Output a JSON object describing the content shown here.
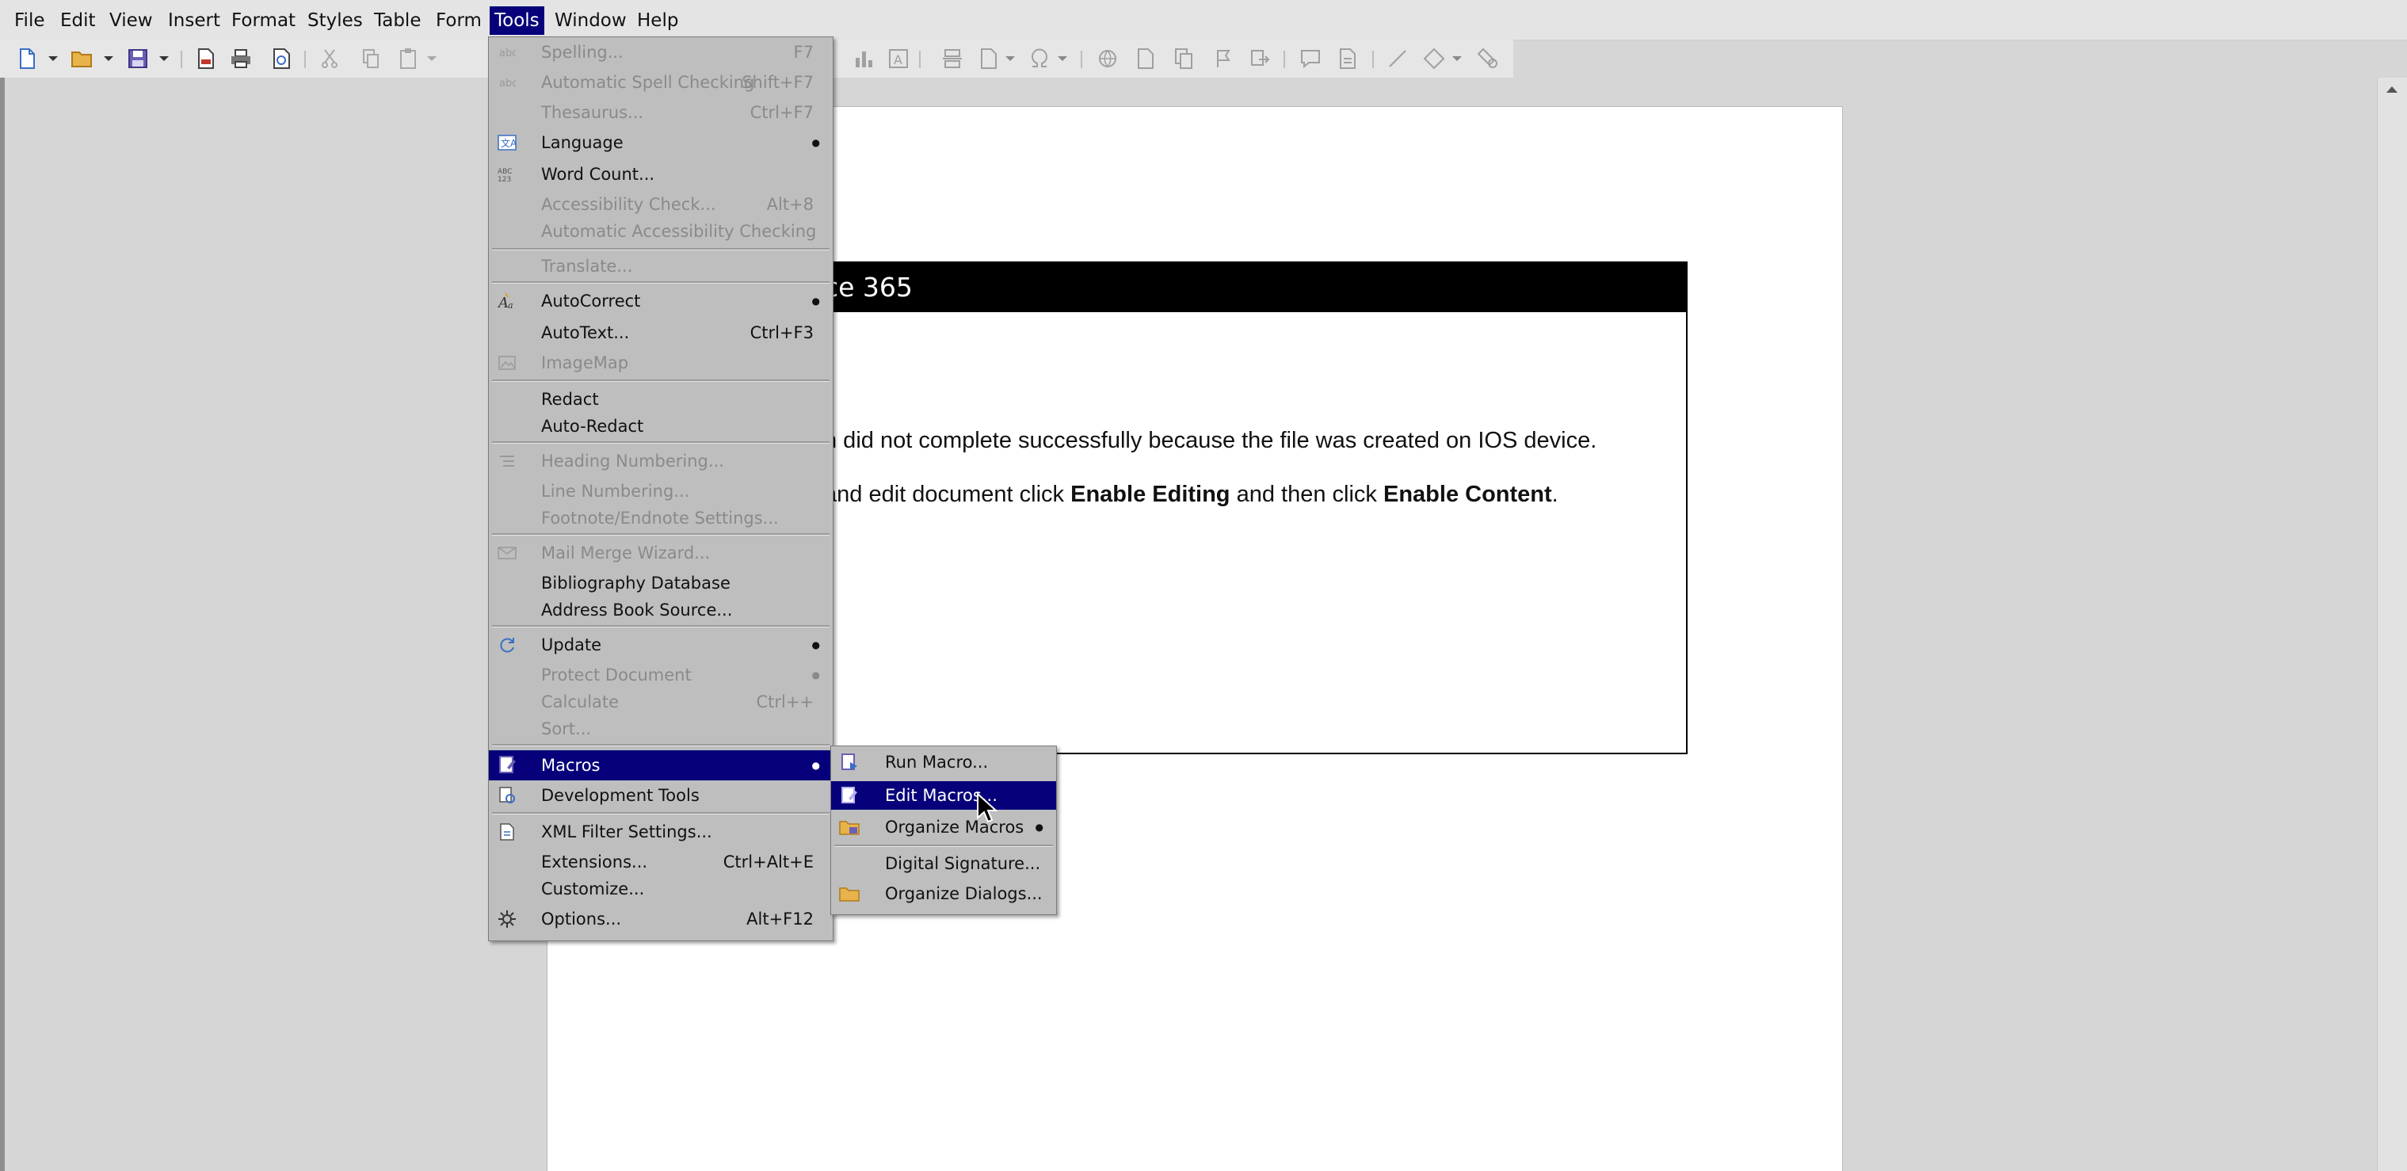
{
  "menubar": {
    "items": [
      {
        "label": "File"
      },
      {
        "label": "Edit"
      },
      {
        "label": "View"
      },
      {
        "label": "Insert"
      },
      {
        "label": "Format"
      },
      {
        "label": "Styles"
      },
      {
        "label": "Table"
      },
      {
        "label": "Form"
      },
      {
        "label": "Tools"
      },
      {
        "label": "Window"
      },
      {
        "label": "Help"
      }
    ],
    "active": "Tools"
  },
  "toolbar": {
    "icons": [
      "new-document-icon",
      "open-folder-icon",
      "save-icon",
      "export-pdf-icon",
      "print-icon",
      "print-preview-icon",
      "cut-icon",
      "copy-icon",
      "paste-icon",
      "chart-icon",
      "text-box-icon",
      "page-break-icon",
      "field-icon",
      "special-character-icon",
      "hyperlink-icon",
      "footnote-icon",
      "endnote-icon",
      "bookmark-icon",
      "cross-reference-icon",
      "comment-icon",
      "track-changes-icon",
      "line-icon",
      "basic-shapes-icon",
      "draw-functions-icon"
    ]
  },
  "document": {
    "notice_title": "ce 365",
    "line1": "n did not complete successfully because the file was created on IOS device.",
    "line2_pre": "and edit document click ",
    "line2_bold1": "Enable Editing",
    "line2_mid": " and then click ",
    "line2_bold2": "Enable Content",
    "line2_post": "."
  },
  "tools_menu": {
    "items": {
      "spelling": {
        "label": "Spelling...",
        "shortcut": "F7"
      },
      "auto_spell": {
        "label": "Automatic Spell Checking",
        "shortcut": "Shift+F7"
      },
      "thesaurus": {
        "label": "Thesaurus...",
        "shortcut": "Ctrl+F7"
      },
      "language": {
        "label": "Language"
      },
      "word_count": {
        "label": "Word Count..."
      },
      "accessibility_check": {
        "label": "Accessibility Check...",
        "shortcut": "Alt+8"
      },
      "auto_accessibility": {
        "label": "Automatic Accessibility Checking"
      },
      "translate": {
        "label": "Translate..."
      },
      "autocorrect": {
        "label": "AutoCorrect"
      },
      "autotext": {
        "label": "AutoText...",
        "shortcut": "Ctrl+F3"
      },
      "imagemap": {
        "label": "ImageMap"
      },
      "redact": {
        "label": "Redact"
      },
      "auto_redact": {
        "label": "Auto-Redact"
      },
      "heading_numbering": {
        "label": "Heading Numbering..."
      },
      "line_numbering": {
        "label": "Line Numbering..."
      },
      "footnote_settings": {
        "label": "Footnote/Endnote Settings..."
      },
      "mail_merge": {
        "label": "Mail Merge Wizard..."
      },
      "bibliography": {
        "label": "Bibliography Database"
      },
      "address_book": {
        "label": "Address Book Source..."
      },
      "update": {
        "label": "Update"
      },
      "protect_document": {
        "label": "Protect Document"
      },
      "calculate": {
        "label": "Calculate",
        "shortcut": "Ctrl++"
      },
      "sort": {
        "label": "Sort..."
      },
      "macros": {
        "label": "Macros"
      },
      "development_tools": {
        "label": "Development Tools"
      },
      "xml_filter": {
        "label": "XML Filter Settings..."
      },
      "extensions": {
        "label": "Extensions...",
        "shortcut": "Ctrl+Alt+E"
      },
      "customize": {
        "label": "Customize..."
      },
      "options": {
        "label": "Options...",
        "shortcut": "Alt+F12"
      }
    }
  },
  "macros_submenu": {
    "items": {
      "run": {
        "label": "Run Macro..."
      },
      "edit": {
        "label": "Edit Macros..."
      },
      "organize": {
        "label": "Organize Macros"
      },
      "digital_signature": {
        "label": "Digital Signature..."
      },
      "organize_dialogs": {
        "label": "Organize Dialogs..."
      }
    }
  },
  "colors": {
    "menu_highlight": "#06007a",
    "menu_background": "#bebebe",
    "menubar_background": "#e4e4e4",
    "workspace": "#d6d6d6"
  }
}
